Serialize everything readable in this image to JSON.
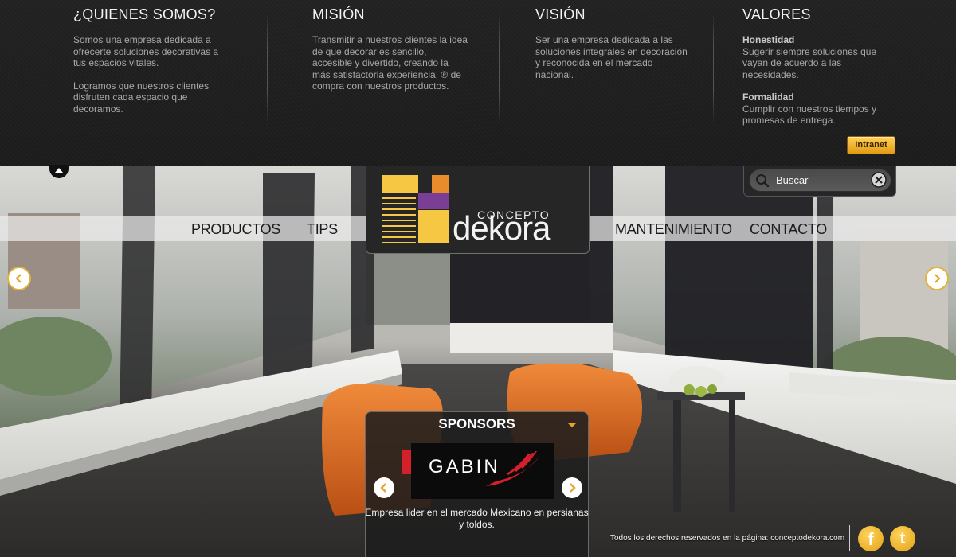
{
  "sections": [
    {
      "title": "¿QUIENES SOMOS?",
      "paragraphs": [
        "Somos una empresa dedicada a ofrecerte soluciones decorativas a tus espacios vitales.",
        "Logramos que nuestros clientes disfruten cada espacio que decoramos."
      ]
    },
    {
      "title": "MISIÓN",
      "paragraphs": [
        "Transmitir a nuestros clientes la idea de que decorar es sencillo, accesible y divertido, creando la más satisfactoria experiencia, ® de compra con nuestros productos."
      ]
    },
    {
      "title": "VISIÓN",
      "paragraphs": [
        "Ser una empresa dedicada a las soluciones integrales en decoración y reconocida en el mercado nacional."
      ]
    },
    {
      "title": "VALORES",
      "values": [
        {
          "name": "Honestidad",
          "text": "Sugerir siempre soluciones que vayan de acuerdo a las necesidades."
        },
        {
          "name": "Formalidad",
          "text": "Cumplir con nuestros tiempos y promesas de entrega."
        }
      ]
    }
  ],
  "intranet_label": "Intranet",
  "nav": {
    "items": [
      "PRODUCTOS",
      "TIPS",
      "MANTENIMIENTO",
      "CONTACTO"
    ]
  },
  "logo": {
    "top": "CONCEPTO",
    "main": "dekora"
  },
  "search": {
    "placeholder": "Buscar",
    "icon": "search-icon",
    "clear_icon": "close-icon"
  },
  "sponsors": {
    "title": "SPONSORS",
    "brand": "GABIN",
    "description": "Empresa lider en el mercado Mexicano en persianas y toldos."
  },
  "footer": {
    "copyright": "Todos los derechos reservados en la página: conceptodekora.com",
    "social": [
      "facebook-icon",
      "twitter-icon"
    ]
  },
  "colors": {
    "accent": "#f0b83a",
    "panel": "#1f1f1f",
    "logo_yellow": "#f6c743",
    "logo_orange": "#e98c2b",
    "logo_purple": "#7a3f95",
    "sponsor_red": "#d4202a"
  }
}
